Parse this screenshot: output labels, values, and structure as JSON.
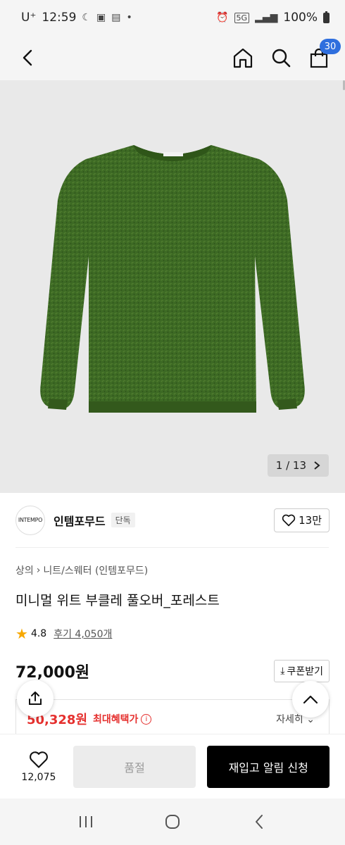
{
  "status_bar": {
    "carrier": "U⁺",
    "time": "12:59",
    "network": "5G",
    "battery": "100%"
  },
  "header": {
    "cart_count": "30"
  },
  "gallery": {
    "counter": "1 / 13",
    "garment_color": "#3d6a24",
    "background_color": "#e9e9e9"
  },
  "brand": {
    "logo_text": "INTEMPO",
    "name": "인템포무드",
    "badge": "단독",
    "likes": "13만"
  },
  "breadcrumb": [
    "상의",
    "니트/스웨터 (인템포무드)"
  ],
  "product": {
    "title": "미니멀 위트 부클레 풀오버_포레스트",
    "rating": "4.8",
    "reviews": "후기 4,050개",
    "price": "72,000원",
    "coupon_label": "쿠폰받기",
    "benefit_price": "50,328원",
    "benefit_label": "최대혜택가",
    "detail_label": "자세히"
  },
  "actions": {
    "wish_count": "12,075",
    "soldout_label": "품절",
    "restock_label": "재입고 알림 신청"
  },
  "colors": {
    "accent_blue": "#2f6fde",
    "benefit_red": "#e5302e",
    "star": "#f7a800"
  }
}
